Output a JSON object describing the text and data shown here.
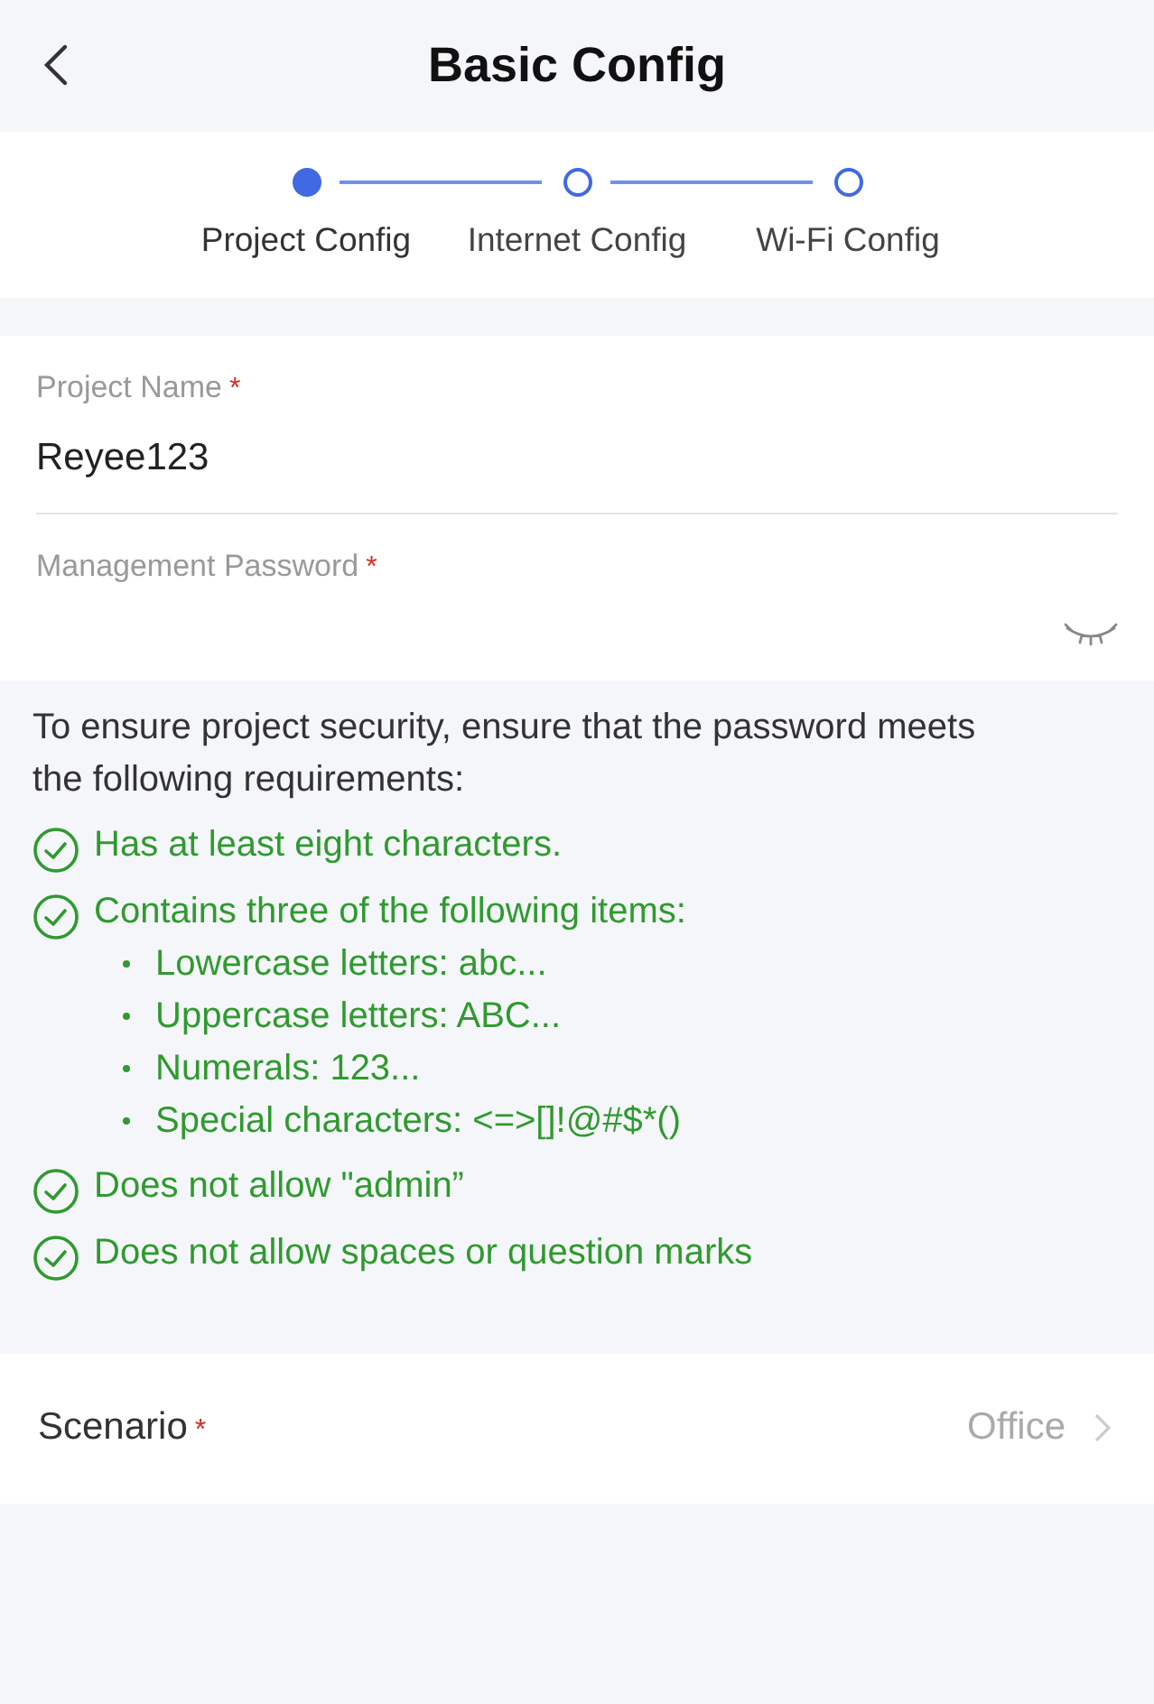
{
  "header": {
    "title": "Basic Config"
  },
  "steps": [
    {
      "label": "Project Config",
      "selected": true
    },
    {
      "label": "Internet Config",
      "selected": false
    },
    {
      "label": "Wi-Fi Config",
      "selected": false
    }
  ],
  "fields": [
    {
      "label": "Project Name",
      "required_mark": "*",
      "value": "Reyee123",
      "kind": "text"
    },
    {
      "label": "Management Password",
      "required_mark": "*",
      "kind": "password"
    }
  ],
  "requirements": {
    "intro": "To ensure project security, ensure that the password meets the following requirements:",
    "items": [
      {
        "text": "Has at least eight characters.",
        "met": true
      },
      {
        "text": "Contains three of the following items:",
        "met": true,
        "children": [
          {
            "text": "Lowercase letters: abc..."
          },
          {
            "text": "Uppercase letters: ABC..."
          },
          {
            "text": "Numerals: 123..."
          },
          {
            "text": "Special characters: <=>[]!@#$*()"
          }
        ]
      },
      {
        "text": "Does not allow \"admin”",
        "met": true
      },
      {
        "text": "Does not allow spaces or question marks",
        "met": true
      }
    ]
  },
  "scenario": {
    "label": "Scenario",
    "required_mark": "*",
    "value": "Office"
  }
}
